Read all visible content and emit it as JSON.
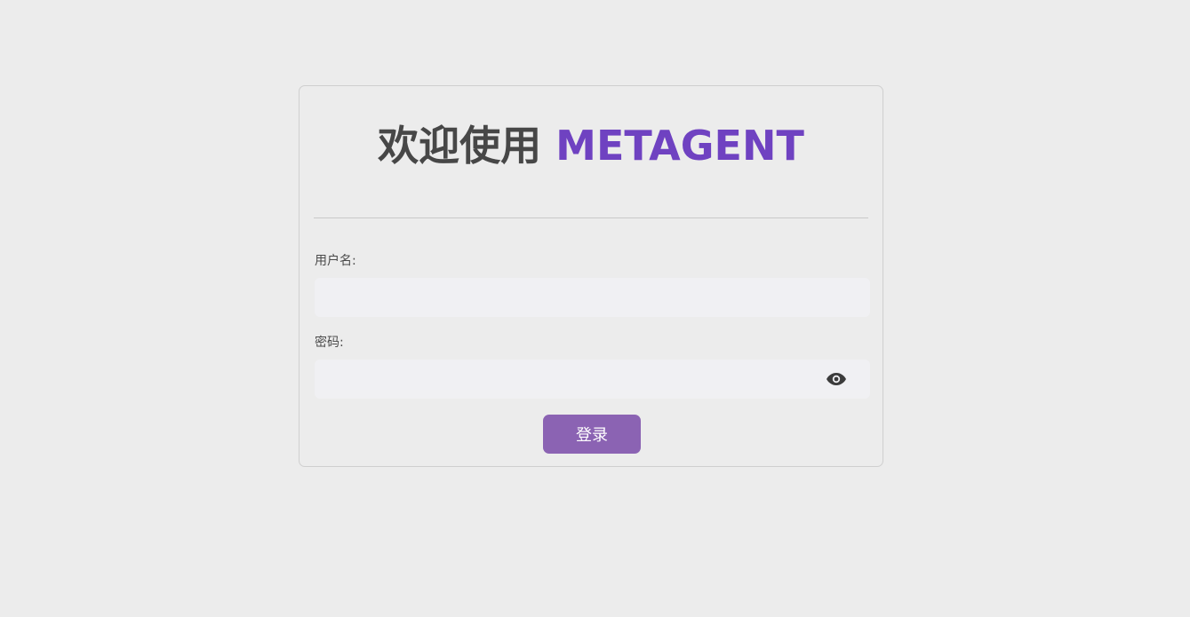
{
  "login": {
    "title_prefix": "欢迎使用 ",
    "title_brand": "METAGENT",
    "username_label": "用户名:",
    "username_value": "",
    "password_label": "密码:",
    "password_value": "",
    "password_toggle_icon": "eye-icon",
    "submit_label": "登录"
  },
  "colors": {
    "background": "#ececec",
    "brand": "#6f42c1",
    "button": "#8b63b3",
    "input_background": "#f0f0f3"
  }
}
